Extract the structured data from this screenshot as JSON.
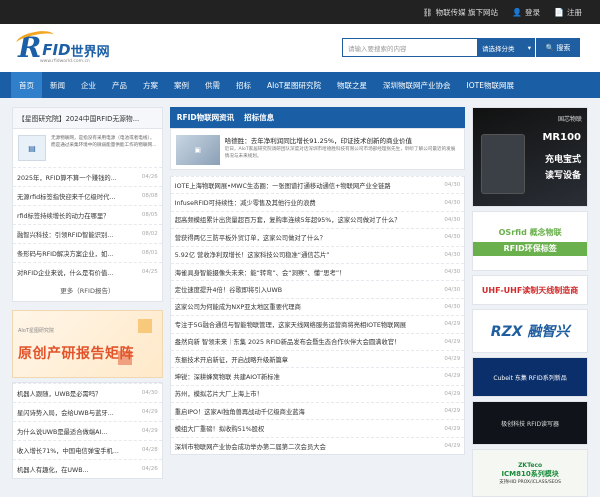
{
  "topbar": {
    "items": [
      {
        "icon": "link-icon",
        "label": "物联传媒 旗下网站"
      },
      {
        "icon": "user-icon",
        "label": "登录"
      },
      {
        "icon": "register-icon",
        "label": "注册"
      }
    ]
  },
  "logo": {
    "r": "R",
    "fid": "FID",
    "cn": "世界网",
    "url": "www.rfidworld.com.cn"
  },
  "search": {
    "placeholder": "请输入要搜索的内容",
    "category": "请选择分类",
    "button": "搜索"
  },
  "nav": [
    "首页",
    "新闻",
    "企业",
    "产品",
    "方案",
    "案例",
    "供需",
    "招标",
    "AIoT星图研究院",
    "物联之星",
    "深圳物联网产业协会",
    "IOTE物联网展"
  ],
  "left": {
    "title": "【星图研究院】2024中国RFID无源物...",
    "feature_text": "无源物联网，是指没有采用电源（电池或者电线），而是通过采集环境中的微弱能量供能工作的物联网...",
    "list": [
      {
        "t": "2025年，RFID算不算一个赚钱的...",
        "d": "04/26"
      },
      {
        "t": "无源rfid标签指快迎来千亿级时代...",
        "d": "08/08"
      },
      {
        "t": "rfid标签持续增长的动力在哪里？",
        "d": "08/05"
      },
      {
        "t": "融智兴科技：引领RFID智能识别...",
        "d": "08/02"
      },
      {
        "t": "条形码与RFID解决方案企业，如...",
        "d": "08/01"
      },
      {
        "t": "对RFID企业来说，什么是有价值...",
        "d": "04/25"
      }
    ],
    "more": "更多（RFID报告）",
    "ad": {
      "small": "AIoT星图研究院",
      "big": "原创产研报告矩阵"
    },
    "list2": [
      {
        "t": "机器人跟随，UWB是必需吗？",
        "d": "04/30"
      },
      {
        "t": "星闪诗势入局，会给UWB与蓝牙...",
        "d": "04/29"
      },
      {
        "t": "为什么说UWB是最适合做端AI...",
        "d": "04/29"
      },
      {
        "t": "收入增长71%，中国电信弹宝手机...",
        "d": "04/28"
      },
      {
        "t": "机器人有趣化，在UWB...",
        "d": "04/26"
      }
    ]
  },
  "middle": {
    "title": "RFID物联网资讯",
    "subtitle": "招标信息",
    "highlight": {
      "title": "哈德胜：去年净利润同比增长91.25%，印证技术创新的商业价值",
      "desc": "近日，AIoT家居研究院调研团队深度对话深圳市哈德胜科技有限公司市场部经理张先生，聆听了解公司最近的发展情况与未来规划。"
    },
    "list": [
      {
        "t": "IOTE上海物联网展•MWC生态圈：一张图谱打通移动通信+物联网产业全链路",
        "d": "04/30"
      },
      {
        "t": "InfuseRFID可持续性：减少零售及其他行业的浪费",
        "d": "04/30"
      },
      {
        "t": "超高频模组累计出货量超百万套，复购率连续5年超95%，这家公司做对了什么？",
        "d": "04/30"
      },
      {
        "t": "营获得两亿三防平板外贸订单，这家公司做对了什么？",
        "d": "04/30"
      },
      {
        "t": "5.92亿 营收净利双增长！这家科技公司稳准“通信芯片”",
        "d": "04/30"
      },
      {
        "t": "海雀具身智能摄像头未来：能“转弯”、会“洞察”、懂“思考”！",
        "d": "04/30"
      },
      {
        "t": "定位速度提升4倍！谷歌即将引入UWB",
        "d": "04/30"
      },
      {
        "t": "这家公司为何能成为NXP亚太地区重要代理商",
        "d": "04/30"
      },
      {
        "t": "专注于5G融合通信与智能物联管理，这家天线网络服务运营商将亮相IOTE物联网展",
        "d": "04/29"
      },
      {
        "t": "盎然向新 智领未来｜东集 2025 RFID新品发布会暨生态合作伙伴大会圆满收官！",
        "d": "04/29"
      },
      {
        "t": "东振技术开启新征，开启战略升级新篇章",
        "d": "04/29"
      },
      {
        "t": "坤锐：深耕蜂窝物联 共建AIOT新标准",
        "d": "04/29"
      },
      {
        "t": "苏州，模拟芯片大厂上海上市！",
        "d": "04/29"
      },
      {
        "t": "重启IPO！这家AI独角兽再战动千亿级商业蓝海",
        "d": "04/29"
      },
      {
        "t": "模组大厂重磅！拟收购51%股权",
        "d": "04/29"
      },
      {
        "t": "深圳市物联网产业协会成功举办第二届第二次会员大会",
        "d": "04/29"
      }
    ]
  },
  "right_ads": {
    "ad1": {
      "brand": "国芯物联",
      "model": "MR100",
      "line1": "充电宝式",
      "line2": "读写设备"
    },
    "ad2": {
      "top": "OSrfid 概念物联",
      "bar": "RFID环保标签"
    },
    "ad3": {
      "text": "UHF-UHF读制天线制造商"
    },
    "ad4": {
      "text": "RZX 融智兴"
    },
    "ad5": {
      "text": "Cubeit 东集 RFID系列新品"
    },
    "ad6": {
      "text": "极创科技 RFID读写器"
    },
    "ad7": {
      "top": "ZKTeco",
      "main": "ICM810系列模块",
      "sub": "支持HID PROX/iCLASS/SEOS"
    }
  },
  "colors": {
    "nav": "#1a5fa5",
    "topbar": "#222222",
    "accent": "#f4a623"
  }
}
